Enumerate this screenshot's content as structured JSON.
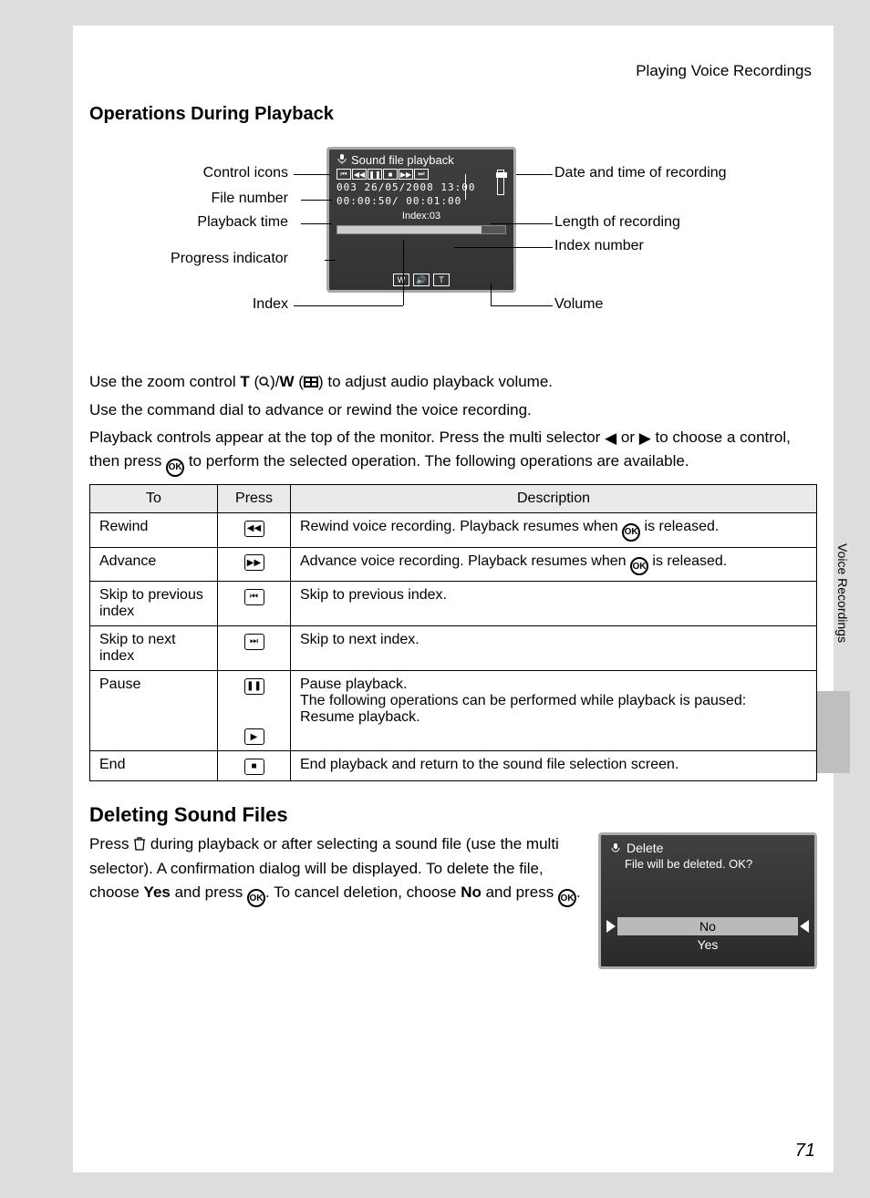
{
  "header": "Playing Voice Recordings",
  "section1_title": "Operations During Playback",
  "lcd": {
    "title": "Sound file playback",
    "file_line": "003 26/05/2008 13:00",
    "time_line": "00:00:50/ 00:01:00",
    "index_line": "Index:03"
  },
  "annotations": {
    "control_icons": "Control icons",
    "file_number": "File number",
    "playback_time": "Playback time",
    "progress_indicator": "Progress indicator",
    "index": "Index",
    "date_time": "Date and time of recording",
    "length": "Length of recording",
    "index_number": "Index number",
    "volume": "Volume"
  },
  "para1_a": "Use the zoom control ",
  "para1_b": " to adjust audio playback volume.",
  "para2": "Use the command dial to advance or rewind the voice recording.",
  "para3_a": "Playback controls appear at the top of the monitor. Press the multi selector ",
  "para3_b": " or ",
  "para3_c": " to choose a control, then press ",
  "para3_d": " to perform the selected operation. The following operations are available.",
  "table": {
    "h1": "To",
    "h2": "Press",
    "h3": "Description",
    "rows": [
      {
        "to": "Rewind",
        "desc_a": "Rewind voice recording. Playback resumes when ",
        "desc_b": " is released."
      },
      {
        "to": "Advance",
        "desc_a": "Advance voice recording. Playback resumes when ",
        "desc_b": " is released."
      },
      {
        "to": "Skip to previous index",
        "desc": "Skip to previous index."
      },
      {
        "to": "Skip to next index",
        "desc": "Skip to next index."
      },
      {
        "to": "Pause",
        "desc1": "Pause playback.",
        "desc2": "The following operations can be performed while playback is paused:",
        "desc3": "Resume playback."
      },
      {
        "to": "End",
        "desc": "End playback and return to the sound file selection screen."
      }
    ]
  },
  "section2_title": "Deleting Sound Files",
  "del_para_a": "Press ",
  "del_para_b": " during playback or after selecting a sound file (use the multi selector). A confirmation dialog will be displayed. To delete the file, choose ",
  "del_yes": "Yes",
  "del_para_c": " and press ",
  "del_para_d": ". To cancel deletion, choose ",
  "del_no": "No",
  "del_para_e": " and press ",
  "del_para_f": ".",
  "del_lcd": {
    "title": "Delete",
    "msg": "File will be deleted. OK?",
    "opt_no": "No",
    "opt_yes": "Yes"
  },
  "side_tab": "Voice Recordings",
  "page_number": "71",
  "zoom_t": "T",
  "zoom_w": "W"
}
